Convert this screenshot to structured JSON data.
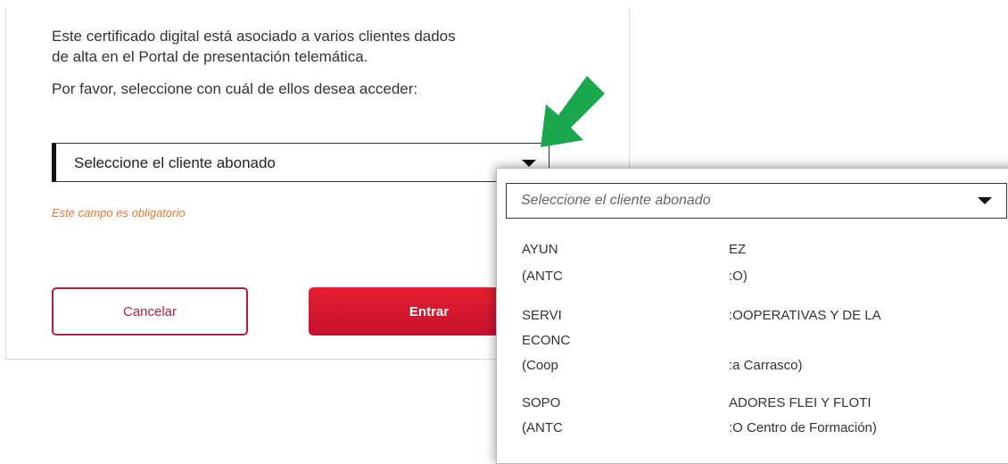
{
  "intro": {
    "line1": "Este certificado digital está asociado a varios clientes dados",
    "line2": "de alta en el Portal de presentación telemática.",
    "prompt": "Por favor, seleccione con cuál de ellos desea acceder:"
  },
  "select": {
    "placeholder": "Seleccione el cliente abonado"
  },
  "validation": {
    "required": "Este campo es obligatorio"
  },
  "buttons": {
    "cancel": "Cancelar",
    "enter": "Entrar"
  },
  "dropdown": {
    "placeholder": "Seleccione el cliente abonado",
    "options": [
      {
        "left_lines": [
          "AYUN",
          "(ANTC"
        ],
        "right_lines": [
          "EZ",
          ":O)"
        ]
      },
      {
        "left_lines": [
          "SERVI",
          "ECONC",
          "(Coop"
        ],
        "right_lines": [
          ":OOPERATIVAS Y DE LA",
          "",
          ":a Carrasco)"
        ]
      },
      {
        "left_lines": [
          "SOPO",
          "(ANTC"
        ],
        "right_lines": [
          "ADORES FLEI Y FLOTI",
          ":O Centro de Formación)"
        ]
      }
    ]
  },
  "colors": {
    "brand_red": "#c8102e",
    "arrow_green": "#1aa64a",
    "warning_orange": "#e07b39"
  },
  "icons": {
    "select_caret": "caret-down-icon",
    "annotation_arrow": "green-arrow-icon"
  }
}
